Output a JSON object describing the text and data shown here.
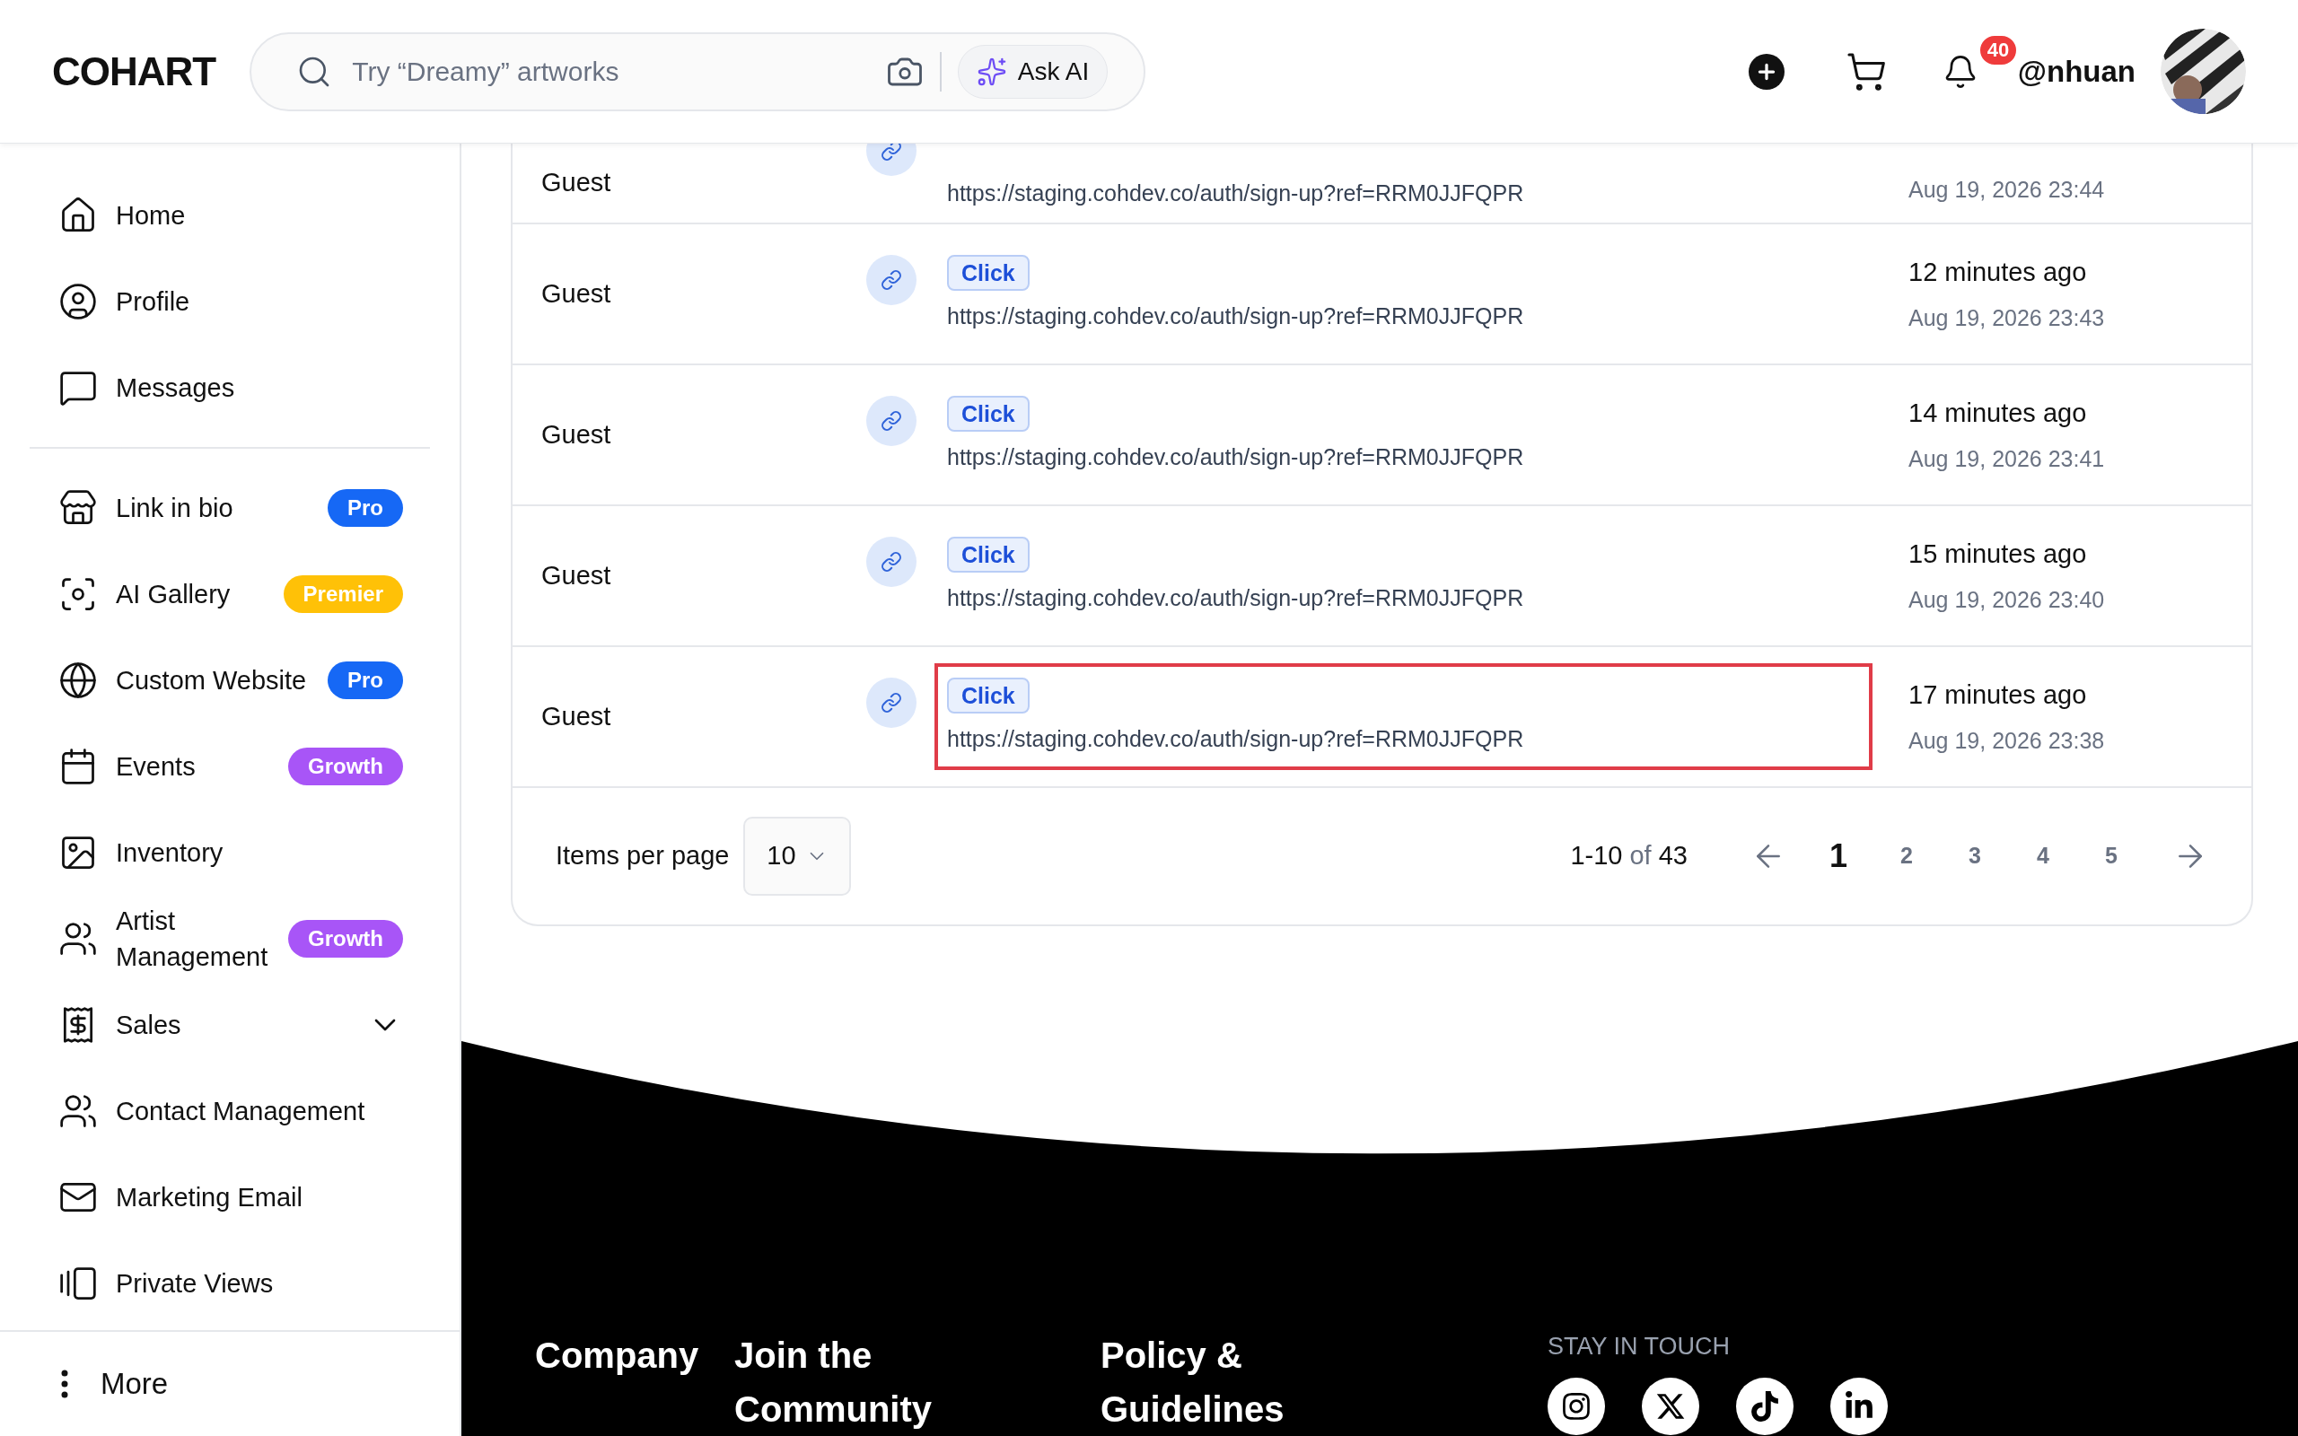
{
  "header": {
    "logo": "COHART",
    "search": {
      "placeholder": "Try “Dreamy” artworks"
    },
    "ask_ai": "Ask AI",
    "notifications": "40",
    "username": "@nhuan"
  },
  "sidebar": {
    "sections": [
      [
        {
          "label": "Home"
        },
        {
          "label": "Profile"
        },
        {
          "label": "Messages"
        }
      ],
      [
        {
          "label": "Link in bio",
          "badge": {
            "text": "Pro",
            "color": "#1668f5"
          }
        },
        {
          "label": "AI Gallery",
          "badge": {
            "text": "Premier",
            "color": "#ffc107"
          }
        },
        {
          "label": "Custom Website",
          "badge": {
            "text": "Pro",
            "color": "#1668f5"
          }
        },
        {
          "label": "Events",
          "badge": {
            "text": "Growth",
            "color": "#a855f7"
          }
        },
        {
          "label": "Inventory"
        },
        {
          "label": "Artist Management",
          "badge": {
            "text": "Growth",
            "color": "#a855f7"
          }
        },
        {
          "label": "Sales",
          "expanded": false
        },
        {
          "label": "Contact Management"
        },
        {
          "label": "Marketing Email"
        },
        {
          "label": "Private Views"
        }
      ]
    ],
    "more": "More"
  },
  "table": {
    "rows": [
      {
        "user": "Guest",
        "url": "https://staging.cohdev.co/auth/sign-up?ref=RRM0JJFQPR",
        "date": "Aug 19, 2026 23:44",
        "highlighted": false
      },
      {
        "user": "Guest",
        "event": "Click",
        "url": "https://staging.cohdev.co/auth/sign-up?ref=RRM0JJFQPR",
        "ago": "12 minutes ago",
        "date": "Aug 19, 2026 23:43",
        "highlighted": false
      },
      {
        "user": "Guest",
        "event": "Click",
        "url": "https://staging.cohdev.co/auth/sign-up?ref=RRM0JJFQPR",
        "ago": "14 minutes ago",
        "date": "Aug 19, 2026 23:41",
        "highlighted": false
      },
      {
        "user": "Guest",
        "event": "Click",
        "url": "https://staging.cohdev.co/auth/sign-up?ref=RRM0JJFQPR",
        "ago": "15 minutes ago",
        "date": "Aug 19, 2026 23:40",
        "highlighted": false
      },
      {
        "user": "Guest",
        "event": "Click",
        "url": "https://staging.cohdev.co/auth/sign-up?ref=RRM0JJFQPR",
        "ago": "17 minutes ago",
        "date": "Aug 19, 2026 23:38",
        "highlighted": true
      }
    ],
    "pagination": {
      "label": "Items per page",
      "per_page": "10",
      "range": "1-10",
      "of": "of",
      "total": "43",
      "pages": [
        {
          "label": "1",
          "selected": true
        },
        {
          "label": "2",
          "selected": false
        },
        {
          "label": "3",
          "selected": false
        },
        {
          "label": "4",
          "selected": false
        },
        {
          "label": "5",
          "selected": false
        }
      ]
    }
  },
  "footer": {
    "columns": [
      "Company",
      "Join the Community",
      "Policy & Guidelines"
    ],
    "stay_in_touch": "STAY IN TOUCH"
  }
}
